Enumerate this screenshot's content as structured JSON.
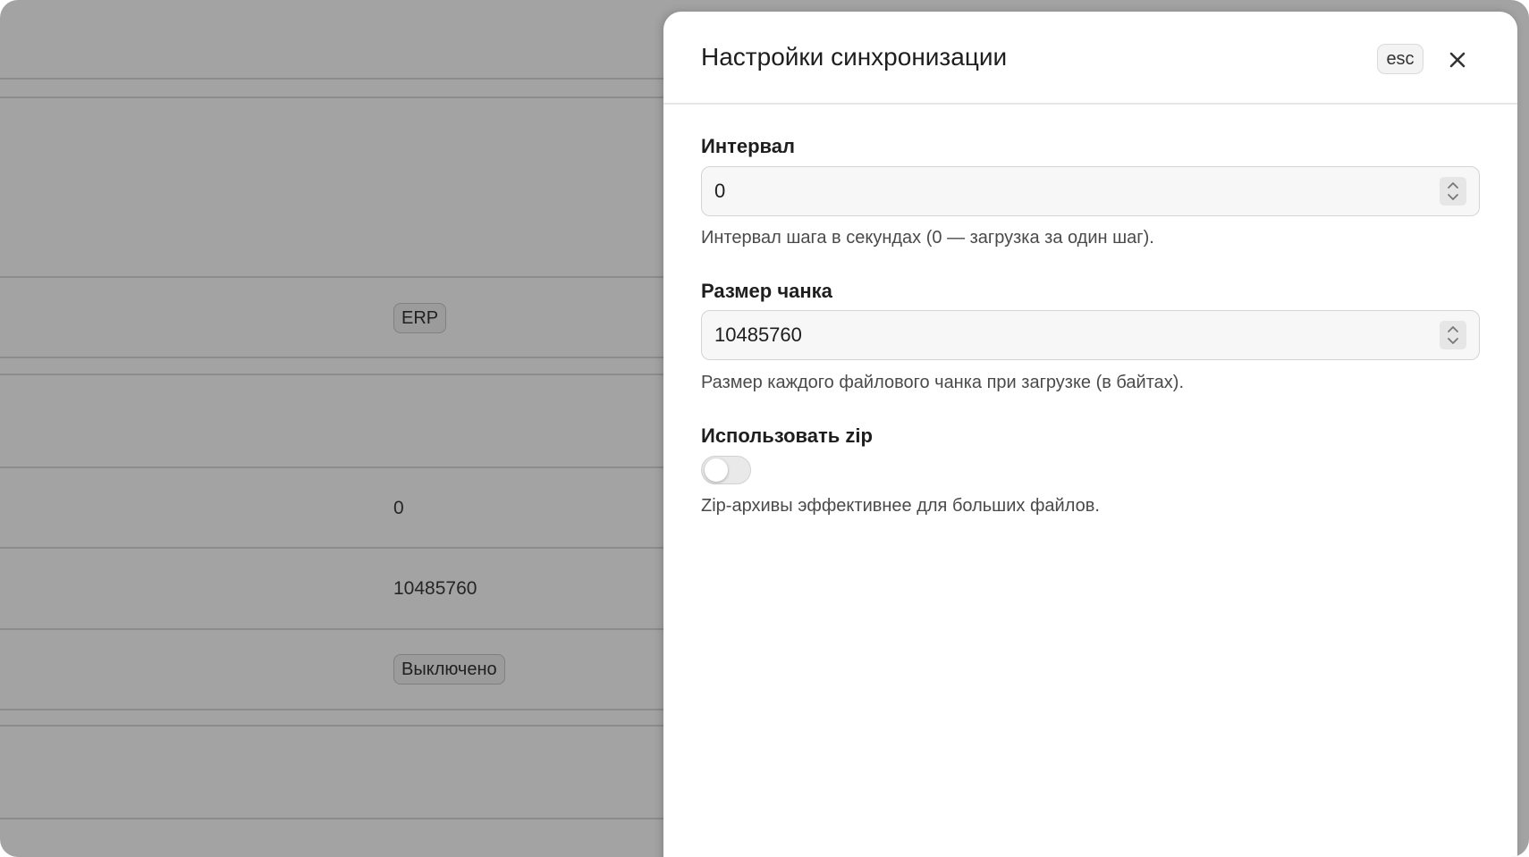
{
  "background": {
    "badge_erp": "ERP",
    "interval_value": "0",
    "chunk_value": "10485760",
    "zip_status": "Выключено"
  },
  "drawer": {
    "title": "Настройки синхронизации",
    "esc_label": "esc",
    "close_icon": "close-icon",
    "fields": {
      "interval": {
        "label": "Интервал",
        "value": "0",
        "help": "Интервал шага в секундах (0 — загрузка за один шаг)."
      },
      "chunk_size": {
        "label": "Размер чанка",
        "value": "10485760",
        "help": "Размер каждого файлового чанка при загрузке (в байтах)."
      },
      "use_zip": {
        "label": "Использовать zip",
        "enabled": false,
        "help": "Zip-архивы эффективнее для больших файлов."
      }
    }
  }
}
